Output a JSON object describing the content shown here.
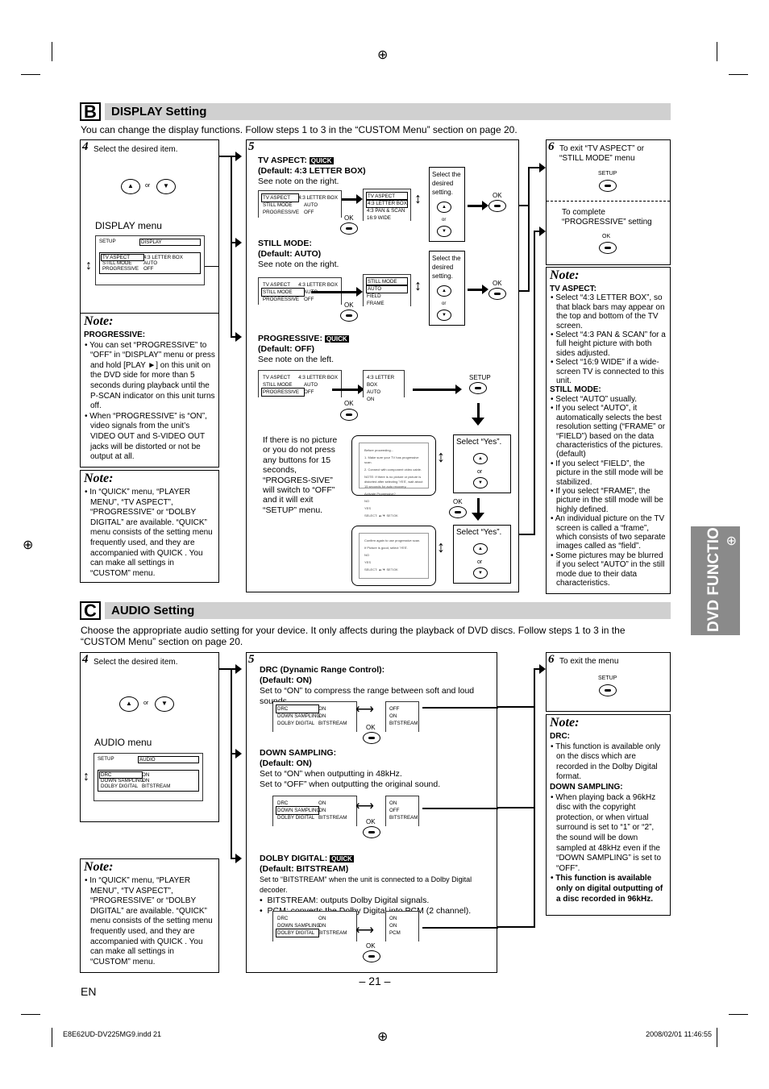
{
  "page": {
    "number": "– 21 –",
    "lang": "EN",
    "footer_file": "E8E62UD-DV225MG9.indd   21",
    "footer_date": "2008/02/01   11:46:55",
    "side_tab": "DVD FUNCTIONS"
  },
  "display": {
    "letter": "B",
    "title": "DISPLAY Setting",
    "intro": "You can change the display functions. Follow steps 1 to 3 in the “CUSTOM Menu” section on page 20.",
    "step4": {
      "num": "4",
      "text": "Select the desired item.",
      "or": "or",
      "menu_label": "DISPLAY menu",
      "screen_header": [
        "SETUP",
        "DISPLAY"
      ],
      "rows": [
        [
          "TV ASPECT",
          "4:3 LETTER BOX"
        ],
        [
          "STILL MODE",
          "AUTO"
        ],
        [
          "PROGRESSIVE",
          "OFF"
        ]
      ]
    },
    "note1": {
      "title": "Note:",
      "heading": "PROGRESSIVE:",
      "items": [
        "You can set “PROGRESSIVE” to “OFF” in “DISPLAY” menu or press and hold [PLAY ►] on this unit on the DVD side for more than 5 seconds during playback until the P-SCAN indicator on this unit turns off.",
        "When “PROGRESSIVE” is “ON”, video signals from the unit’s VIDEO OUT and S-VIDEO OUT jacks will be distorted or not be output at all."
      ]
    },
    "note2": {
      "title": "Note:",
      "items": [
        "In “QUICK” menu, “PLAYER MENU”, “TV ASPECT”, “PROGRESSIVE” or “DOLBY DIGITAL” are available. “QUICK” menu consists of the setting menu frequently used, and they are accompanied with QUICK . You can make all settings in “CUSTOM” menu."
      ]
    },
    "step5": {
      "num": "5",
      "quick": "QUICK",
      "ok": "OK",
      "setup": "SETUP",
      "select_desired": "Select the desired setting.",
      "or": "or",
      "tv_aspect": {
        "title": "TV ASPECT:",
        "default": "(Default: 4:3 LETTER BOX)",
        "see": "See note on the right.",
        "list": [
          "TV ASPECT",
          "4:3 LETTER BOX",
          "4:3 PAN & SCAN",
          "16:9 WIDE"
        ]
      },
      "still_mode": {
        "title": "STILL MODE:",
        "default": "(Default: AUTO)",
        "see": "See note on the right.",
        "list": [
          "STILL MODE",
          "AUTO",
          "FIELD",
          "FRAME"
        ]
      },
      "progressive": {
        "title": "PROGRESSIVE:",
        "default": "(Default: OFF)",
        "see": "See note on the left.",
        "values": [
          "4:3 LETTER BOX",
          "AUTO",
          "ON"
        ]
      },
      "no_picture": "If there is no picture or you do not press any buttons for 15 seconds, “PROGRES-SIVE” will switch to “OFF” and it will exit “SETUP” menu.",
      "select_yes": "Select “Yes”.",
      "dialog1": [
        "Before proceeding...",
        "1. Make sure your TV has progressive scan.",
        "2. Connect with component video cable.",
        "NOTE: If there is no picture or picture is distorted after selecting 'YES', wait about 15 seconds for auto recovery.",
        "Activate Progressive?",
        "NO",
        "YES",
        "SELECT: ▲/▼      SET:OK"
      ],
      "dialog2": [
        "Confirm again to use progressive scan.",
        "If Picture is good, select 'YES'.",
        "NO",
        "YES",
        "SELECT: ▲/▼      SET:OK"
      ]
    },
    "step6": {
      "num": "6",
      "text": "To exit “TV ASPECT” or “STILL MODE” menu",
      "setup": "SETUP",
      "complete": "To complete “PROGRESSIVE” setting",
      "ok": "OK"
    },
    "note3": {
      "title": "Note:",
      "sections": [
        {
          "heading": "TV ASPECT:",
          "items": [
            "Select “4:3 LETTER BOX”, so that black bars may appear on the top and bottom of the TV screen.",
            "Select “4:3 PAN & SCAN” for a full height picture with both sides adjusted.",
            "Select “16:9 WIDE” if a wide-screen TV is connected to this unit."
          ]
        },
        {
          "heading": "STILL MODE:",
          "items": [
            "Select “AUTO” usually.",
            "If you select “AUTO”, it automatically selects the best resolution setting (“FRAME” or “FIELD”) based on the data characteristics of the pictures. (default)",
            "If you select “FIELD”, the picture in the still mode will be stabilized.",
            "If you select “FRAME”, the picture in the still mode will be highly defined.",
            "An individual picture on the TV screen is called a “frame”, which consists of two separate images called as “field”.",
            "Some pictures may be blurred if you select “AUTO” in the still mode due to their data characteristics."
          ]
        }
      ]
    }
  },
  "audio": {
    "letter": "C",
    "title": "AUDIO Setting",
    "intro": "Choose the appropriate audio setting for your device. It only affects during the playback of DVD discs. Follow steps 1 to 3 in the “CUSTOM Menu” section on page 20.",
    "step4": {
      "num": "4",
      "text": "Select the desired item.",
      "or": "or",
      "menu_label": "AUDIO menu",
      "screen_header": [
        "SETUP",
        "AUDIO"
      ],
      "rows": [
        [
          "DRC",
          "ON"
        ],
        [
          "DOWN SAMPLING",
          "ON"
        ],
        [
          "DOLBY DIGITAL",
          "BITSTREAM"
        ]
      ]
    },
    "note": {
      "title": "Note:",
      "items": [
        "In “QUICK” menu, “PLAYER MENU”, “TV ASPECT”, “PROGRESSIVE” or “DOLBY DIGITAL” are available. “QUICK” menu consists of the setting menu frequently used, and they are accompanied with QUICK . You can make all settings in “CUSTOM” menu."
      ]
    },
    "step5": {
      "num": "5",
      "ok": "OK",
      "quick": "QUICK",
      "drc": {
        "title": "DRC (Dynamic Range Control):",
        "default": "(Default: ON)",
        "desc": "Set to “ON” to compress the range between soft and loud sounds.",
        "after": [
          "OFF",
          "ON",
          "BITSTREAM"
        ]
      },
      "down_sampling": {
        "title": "DOWN SAMPLING:",
        "default": "(Default: ON)",
        "desc1": "Set to “ON” when outputting in 48kHz.",
        "desc2": "Set to “OFF” when outputting the original sound.",
        "after": [
          "ON",
          "OFF",
          "BITSTREAM"
        ]
      },
      "dolby_digital": {
        "title": "DOLBY DIGITAL:",
        "default": "(Default: BITSTREAM)",
        "desc": "Set to “BITSTREAM” when the unit is connected to a Dolby Digital decoder.",
        "bullets": [
          "BITSTREAM: outputs Dolby Digital signals.",
          "PCM: converts the Dolby Digital into PCM (2 channel)."
        ],
        "after": [
          "ON",
          "ON",
          "PCM"
        ]
      }
    },
    "step6": {
      "num": "6",
      "text": "To exit the menu",
      "setup": "SETUP"
    },
    "note2": {
      "title": "Note:",
      "sections": [
        {
          "heading": "DRC:",
          "items": [
            "This function is available only on the discs which are recorded in the Dolby Digital format."
          ]
        },
        {
          "heading": "DOWN SAMPLING:",
          "items": [
            "When playing back a 96kHz disc with the copyright protection, or when virtual surround is set to “1” or “2”, the sound will be down sampled at 48kHz even if the “DOWN SAMPLING” is set to “OFF”."
          ],
          "bold_item": "This function is available only on digital outputting of a disc recorded in 96kHz."
        }
      ]
    }
  }
}
